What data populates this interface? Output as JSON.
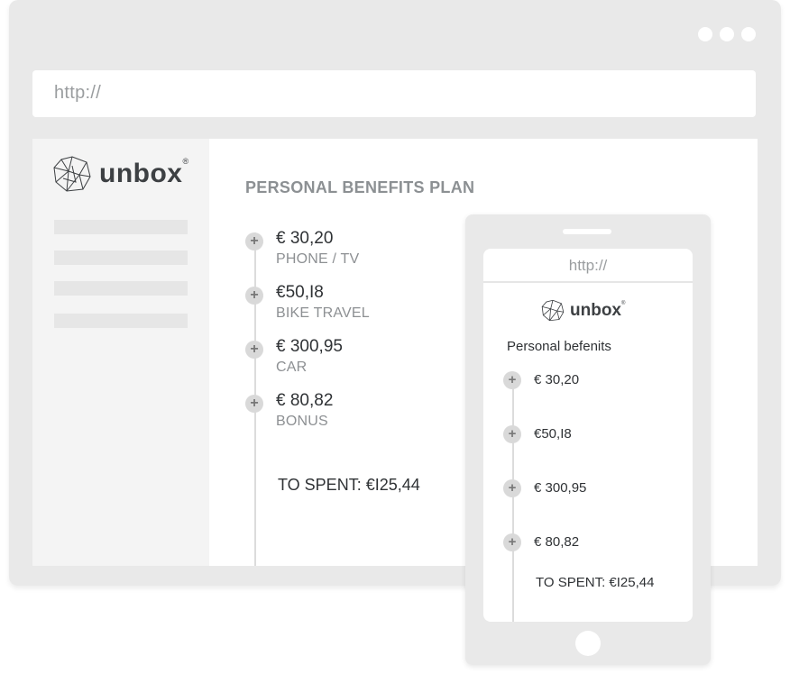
{
  "browser": {
    "url_placeholder": "http://"
  },
  "brand": {
    "name": "unbox",
    "mark": "®"
  },
  "main": {
    "title": "PERSONAL BENEFITS PLAN",
    "items": [
      {
        "amount": "€ 30,20",
        "label": "PHONE / TV"
      },
      {
        "amount": "€50,I8",
        "label": "BIKE TRAVEL"
      },
      {
        "amount": "€ 300,95",
        "label": "CAR"
      },
      {
        "amount": "€ 80,82",
        "label": "BONUS"
      }
    ],
    "total": "TO SPENT:  €I25,44"
  },
  "phone": {
    "url_placeholder": "http://",
    "title": "Personal befenits",
    "items": [
      {
        "amount": "€ 30,20"
      },
      {
        "amount": "€50,I8"
      },
      {
        "amount": "€ 300,95"
      },
      {
        "amount": "€ 80,82"
      }
    ],
    "total": "TO SPENT:  €I25,44"
  },
  "icons": {
    "add": "plus-icon",
    "logo": "geodesic-logo-icon"
  },
  "colors": {
    "frame": "#e9e9e9",
    "sidebar": "#f4f4f4",
    "title_gray": "#8c9093",
    "text_dark": "#2f3235"
  }
}
